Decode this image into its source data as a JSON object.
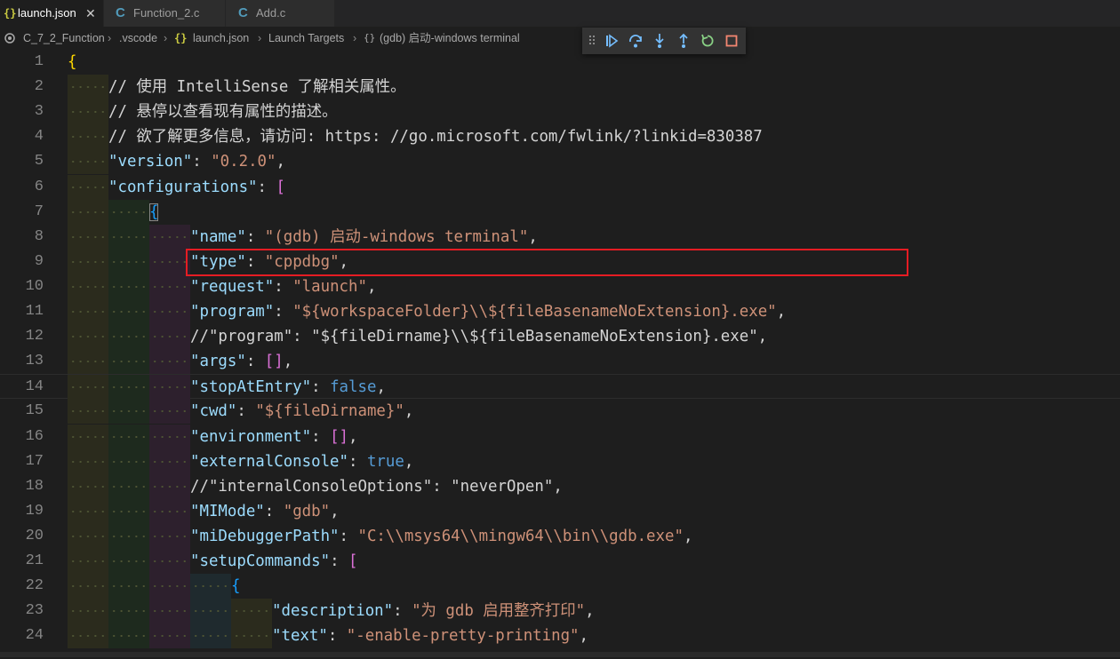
{
  "tabs": [
    {
      "label": "launch.json",
      "icon": "json-braces-icon",
      "active": true,
      "close": "✕"
    },
    {
      "label": "Function_2.c",
      "icon": "c-file-icon",
      "active": false
    },
    {
      "label": "Add.c",
      "icon": "c-file-icon",
      "active": false
    }
  ],
  "breadcrumb": {
    "folder": "C_7_2_Function",
    "subfolder": ".vscode",
    "file": "launch.json",
    "section": "Launch Targets",
    "item": "(gdb) 启动-windows terminal"
  },
  "debug_toolbar": [
    {
      "name": "continue",
      "icon": "continue-icon"
    },
    {
      "name": "step-over",
      "icon": "step-over-icon"
    },
    {
      "name": "step-into",
      "icon": "step-into-icon"
    },
    {
      "name": "step-out",
      "icon": "step-out-icon"
    },
    {
      "name": "restart",
      "icon": "restart-icon"
    },
    {
      "name": "stop",
      "icon": "stop-icon"
    }
  ],
  "colors": {
    "editor_bg": "#1e1e1e",
    "key": "#9cdcfe",
    "string": "#ce9178",
    "comment": "#d4d4d4",
    "keyword": "#569cd6",
    "highlight_box": "#e51c23"
  },
  "editor": {
    "highlighted_line": 11,
    "lines": [
      {
        "n": "1",
        "depth": 0,
        "tokens": [
          [
            "br1",
            "{"
          ]
        ]
      },
      {
        "n": "2",
        "depth": 1,
        "tokens": [
          [
            "c",
            "// 使用 IntelliSense 了解相关属性。"
          ]
        ]
      },
      {
        "n": "3",
        "depth": 1,
        "tokens": [
          [
            "c",
            "// 悬停以查看现有属性的描述。"
          ]
        ]
      },
      {
        "n": "4",
        "depth": 1,
        "tokens": [
          [
            "c",
            "// 欲了解更多信息，请访问: https: //go.microsoft.com/fwlink/?linkid=830387"
          ]
        ]
      },
      {
        "n": "5",
        "depth": 1,
        "tokens": [
          [
            "k",
            "\"version\""
          ],
          [
            "p",
            ": "
          ],
          [
            "s",
            "\"0.2.0\""
          ],
          [
            "p",
            ","
          ]
        ]
      },
      {
        "n": "6",
        "depth": 1,
        "tokens": [
          [
            "k",
            "\"configurations\""
          ],
          [
            "p",
            ": "
          ],
          [
            "br2",
            "["
          ]
        ]
      },
      {
        "n": "7",
        "depth": 2,
        "tokens": [
          [
            "br3bm",
            "{"
          ]
        ]
      },
      {
        "n": "8",
        "depth": 3,
        "tokens": [
          [
            "k",
            "\"name\""
          ],
          [
            "p",
            ": "
          ],
          [
            "s",
            "\"(gdb) 启动-windows terminal\""
          ],
          [
            "p",
            ","
          ]
        ]
      },
      {
        "n": "9",
        "depth": 3,
        "tokens": [
          [
            "k",
            "\"type\""
          ],
          [
            "p",
            ": "
          ],
          [
            "s",
            "\"cppdbg\""
          ],
          [
            "p",
            ","
          ]
        ]
      },
      {
        "n": "10",
        "depth": 3,
        "tokens": [
          [
            "k",
            "\"request\""
          ],
          [
            "p",
            ": "
          ],
          [
            "s",
            "\"launch\""
          ],
          [
            "p",
            ","
          ]
        ]
      },
      {
        "n": "11",
        "depth": 3,
        "tokens": [
          [
            "k",
            "\"program\""
          ],
          [
            "p",
            ": "
          ],
          [
            "s",
            "\"${workspaceFolder}\\\\${fileBasenameNoExtension}.exe\""
          ],
          [
            "p",
            ","
          ]
        ]
      },
      {
        "n": "12",
        "depth": 3,
        "tokens": [
          [
            "c",
            "//\"program\": \"${fileDirname}\\\\${fileBasenameNoExtension}.exe\","
          ]
        ]
      },
      {
        "n": "13",
        "depth": 3,
        "tokens": [
          [
            "k",
            "\"args\""
          ],
          [
            "p",
            ": "
          ],
          [
            "br2",
            "[]"
          ],
          [
            "p",
            ","
          ]
        ]
      },
      {
        "n": "14",
        "depth": 3,
        "cursor": true,
        "tokens": [
          [
            "k",
            "\"stopAtEntry\""
          ],
          [
            "p",
            ": "
          ],
          [
            "b",
            "false"
          ],
          [
            "p",
            ","
          ]
        ]
      },
      {
        "n": "15",
        "depth": 3,
        "tokens": [
          [
            "k",
            "\"cwd\""
          ],
          [
            "p",
            ": "
          ],
          [
            "s",
            "\"${fileDirname}\""
          ],
          [
            "p",
            ","
          ]
        ]
      },
      {
        "n": "16",
        "depth": 3,
        "tokens": [
          [
            "k",
            "\"environment\""
          ],
          [
            "p",
            ": "
          ],
          [
            "br2",
            "[]"
          ],
          [
            "p",
            ","
          ]
        ]
      },
      {
        "n": "17",
        "depth": 3,
        "tokens": [
          [
            "k",
            "\"externalConsole\""
          ],
          [
            "p",
            ": "
          ],
          [
            "b",
            "true"
          ],
          [
            "p",
            ","
          ]
        ]
      },
      {
        "n": "18",
        "depth": 3,
        "tokens": [
          [
            "c",
            "//\"internalConsoleOptions\": \"neverOpen\","
          ]
        ]
      },
      {
        "n": "19",
        "depth": 3,
        "tokens": [
          [
            "k",
            "\"MIMode\""
          ],
          [
            "p",
            ": "
          ],
          [
            "s",
            "\"gdb\""
          ],
          [
            "p",
            ","
          ]
        ]
      },
      {
        "n": "20",
        "depth": 3,
        "tokens": [
          [
            "k",
            "\"miDebuggerPath\""
          ],
          [
            "p",
            ": "
          ],
          [
            "s",
            "\"C:\\\\msys64\\\\mingw64\\\\bin\\\\gdb.exe\""
          ],
          [
            "p",
            ","
          ]
        ]
      },
      {
        "n": "21",
        "depth": 3,
        "tokens": [
          [
            "k",
            "\"setupCommands\""
          ],
          [
            "p",
            ": "
          ],
          [
            "br2",
            "["
          ]
        ]
      },
      {
        "n": "22",
        "depth": 4,
        "tokens": [
          [
            "br3",
            "{"
          ]
        ]
      },
      {
        "n": "23",
        "depth": 5,
        "tokens": [
          [
            "k",
            "\"description\""
          ],
          [
            "p",
            ": "
          ],
          [
            "s",
            "\"为 gdb 启用整齐打印\""
          ],
          [
            "p",
            ","
          ]
        ]
      },
      {
        "n": "24",
        "depth": 5,
        "tokens": [
          [
            "k",
            "\"text\""
          ],
          [
            "p",
            ": "
          ],
          [
            "s",
            "\"-enable-pretty-printing\""
          ],
          [
            "p",
            ","
          ]
        ]
      }
    ]
  }
}
